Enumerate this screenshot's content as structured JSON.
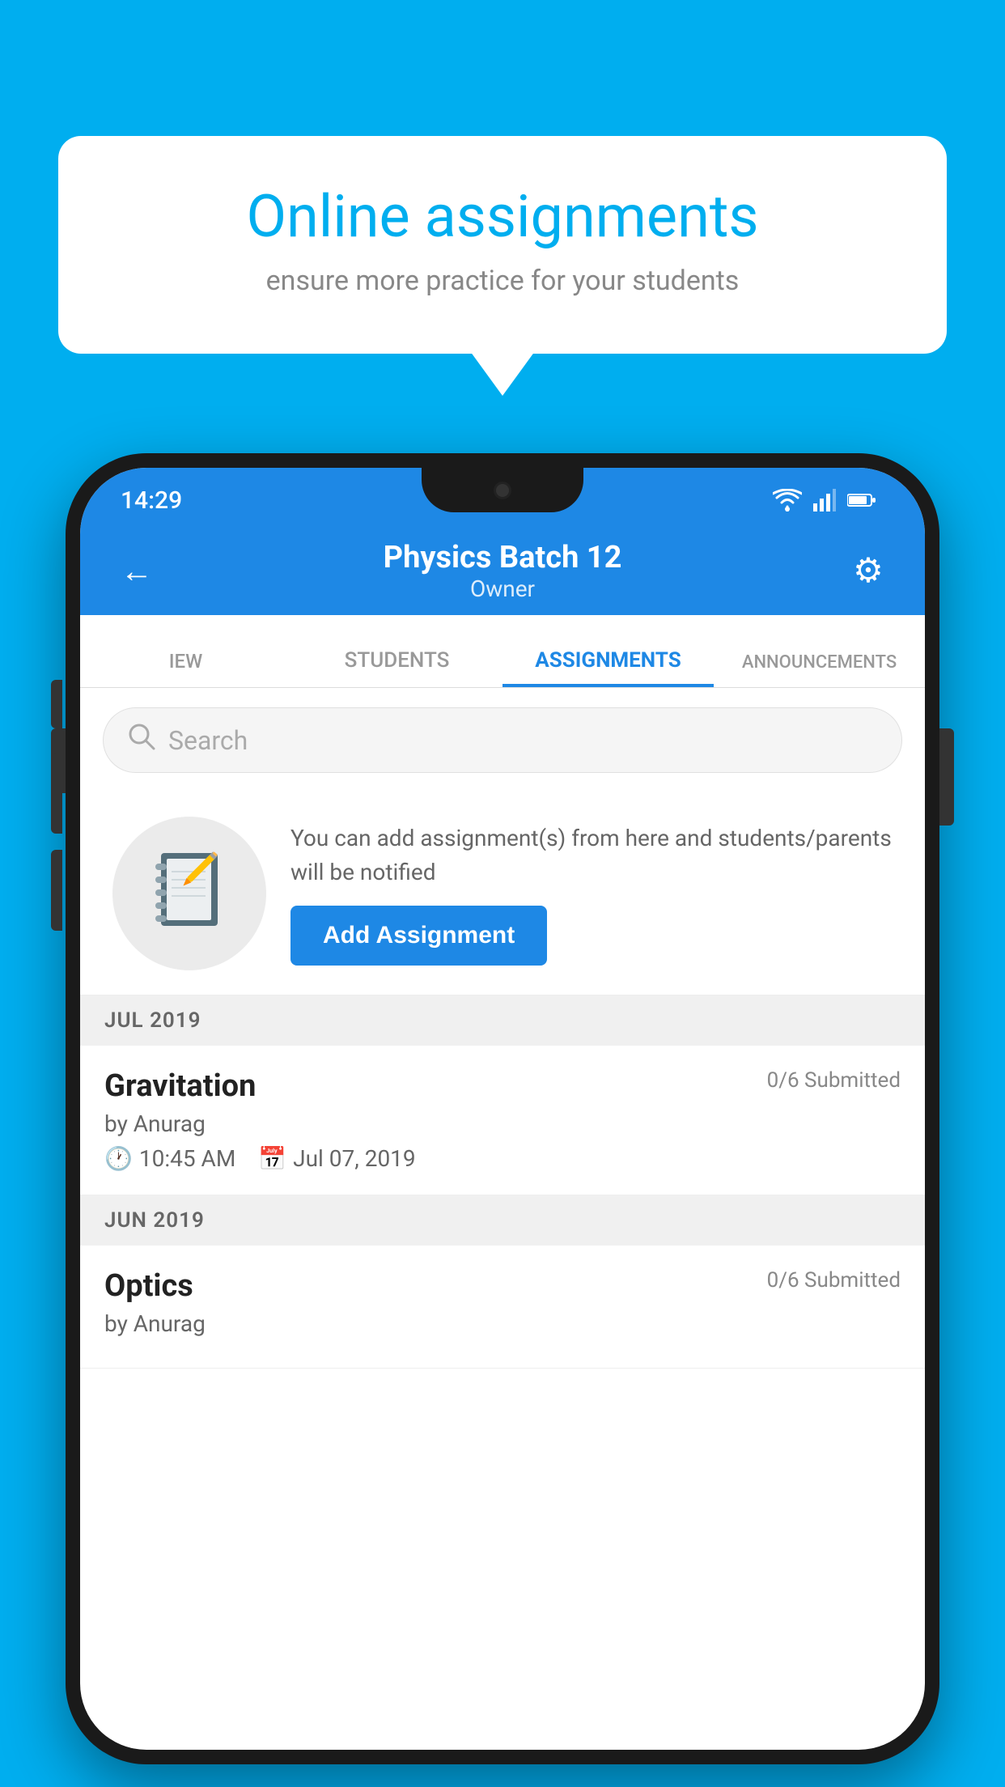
{
  "background": {
    "color": "#00AEEF"
  },
  "speech_bubble": {
    "title": "Online assignments",
    "subtitle": "ensure more practice for your students"
  },
  "phone": {
    "status_bar": {
      "time": "14:29",
      "wifi_icon": "▲",
      "signal_icon": "▲",
      "battery_icon": "▌"
    },
    "header": {
      "back_label": "←",
      "title": "Physics Batch 12",
      "subtitle": "Owner",
      "gear_label": "⚙"
    },
    "tabs": [
      {
        "id": "iew",
        "label": "IEW",
        "active": false
      },
      {
        "id": "students",
        "label": "STUDENTS",
        "active": false
      },
      {
        "id": "assignments",
        "label": "ASSIGNMENTS",
        "active": true
      },
      {
        "id": "announcements",
        "label": "ANNOUNCEMENTS",
        "active": false
      }
    ],
    "search": {
      "placeholder": "Search"
    },
    "add_assignment_card": {
      "description": "You can add assignment(s) from here and students/parents will be notified",
      "button_label": "Add Assignment"
    },
    "sections": [
      {
        "label": "JUL 2019",
        "assignments": [
          {
            "title": "Gravitation",
            "submitted": "0/6 Submitted",
            "author": "by Anurag",
            "time": "10:45 AM",
            "date": "Jul 07, 2019"
          }
        ]
      },
      {
        "label": "JUN 2019",
        "assignments": [
          {
            "title": "Optics",
            "submitted": "0/6 Submitted",
            "author": "by Anurag",
            "time": "",
            "date": ""
          }
        ]
      }
    ]
  }
}
